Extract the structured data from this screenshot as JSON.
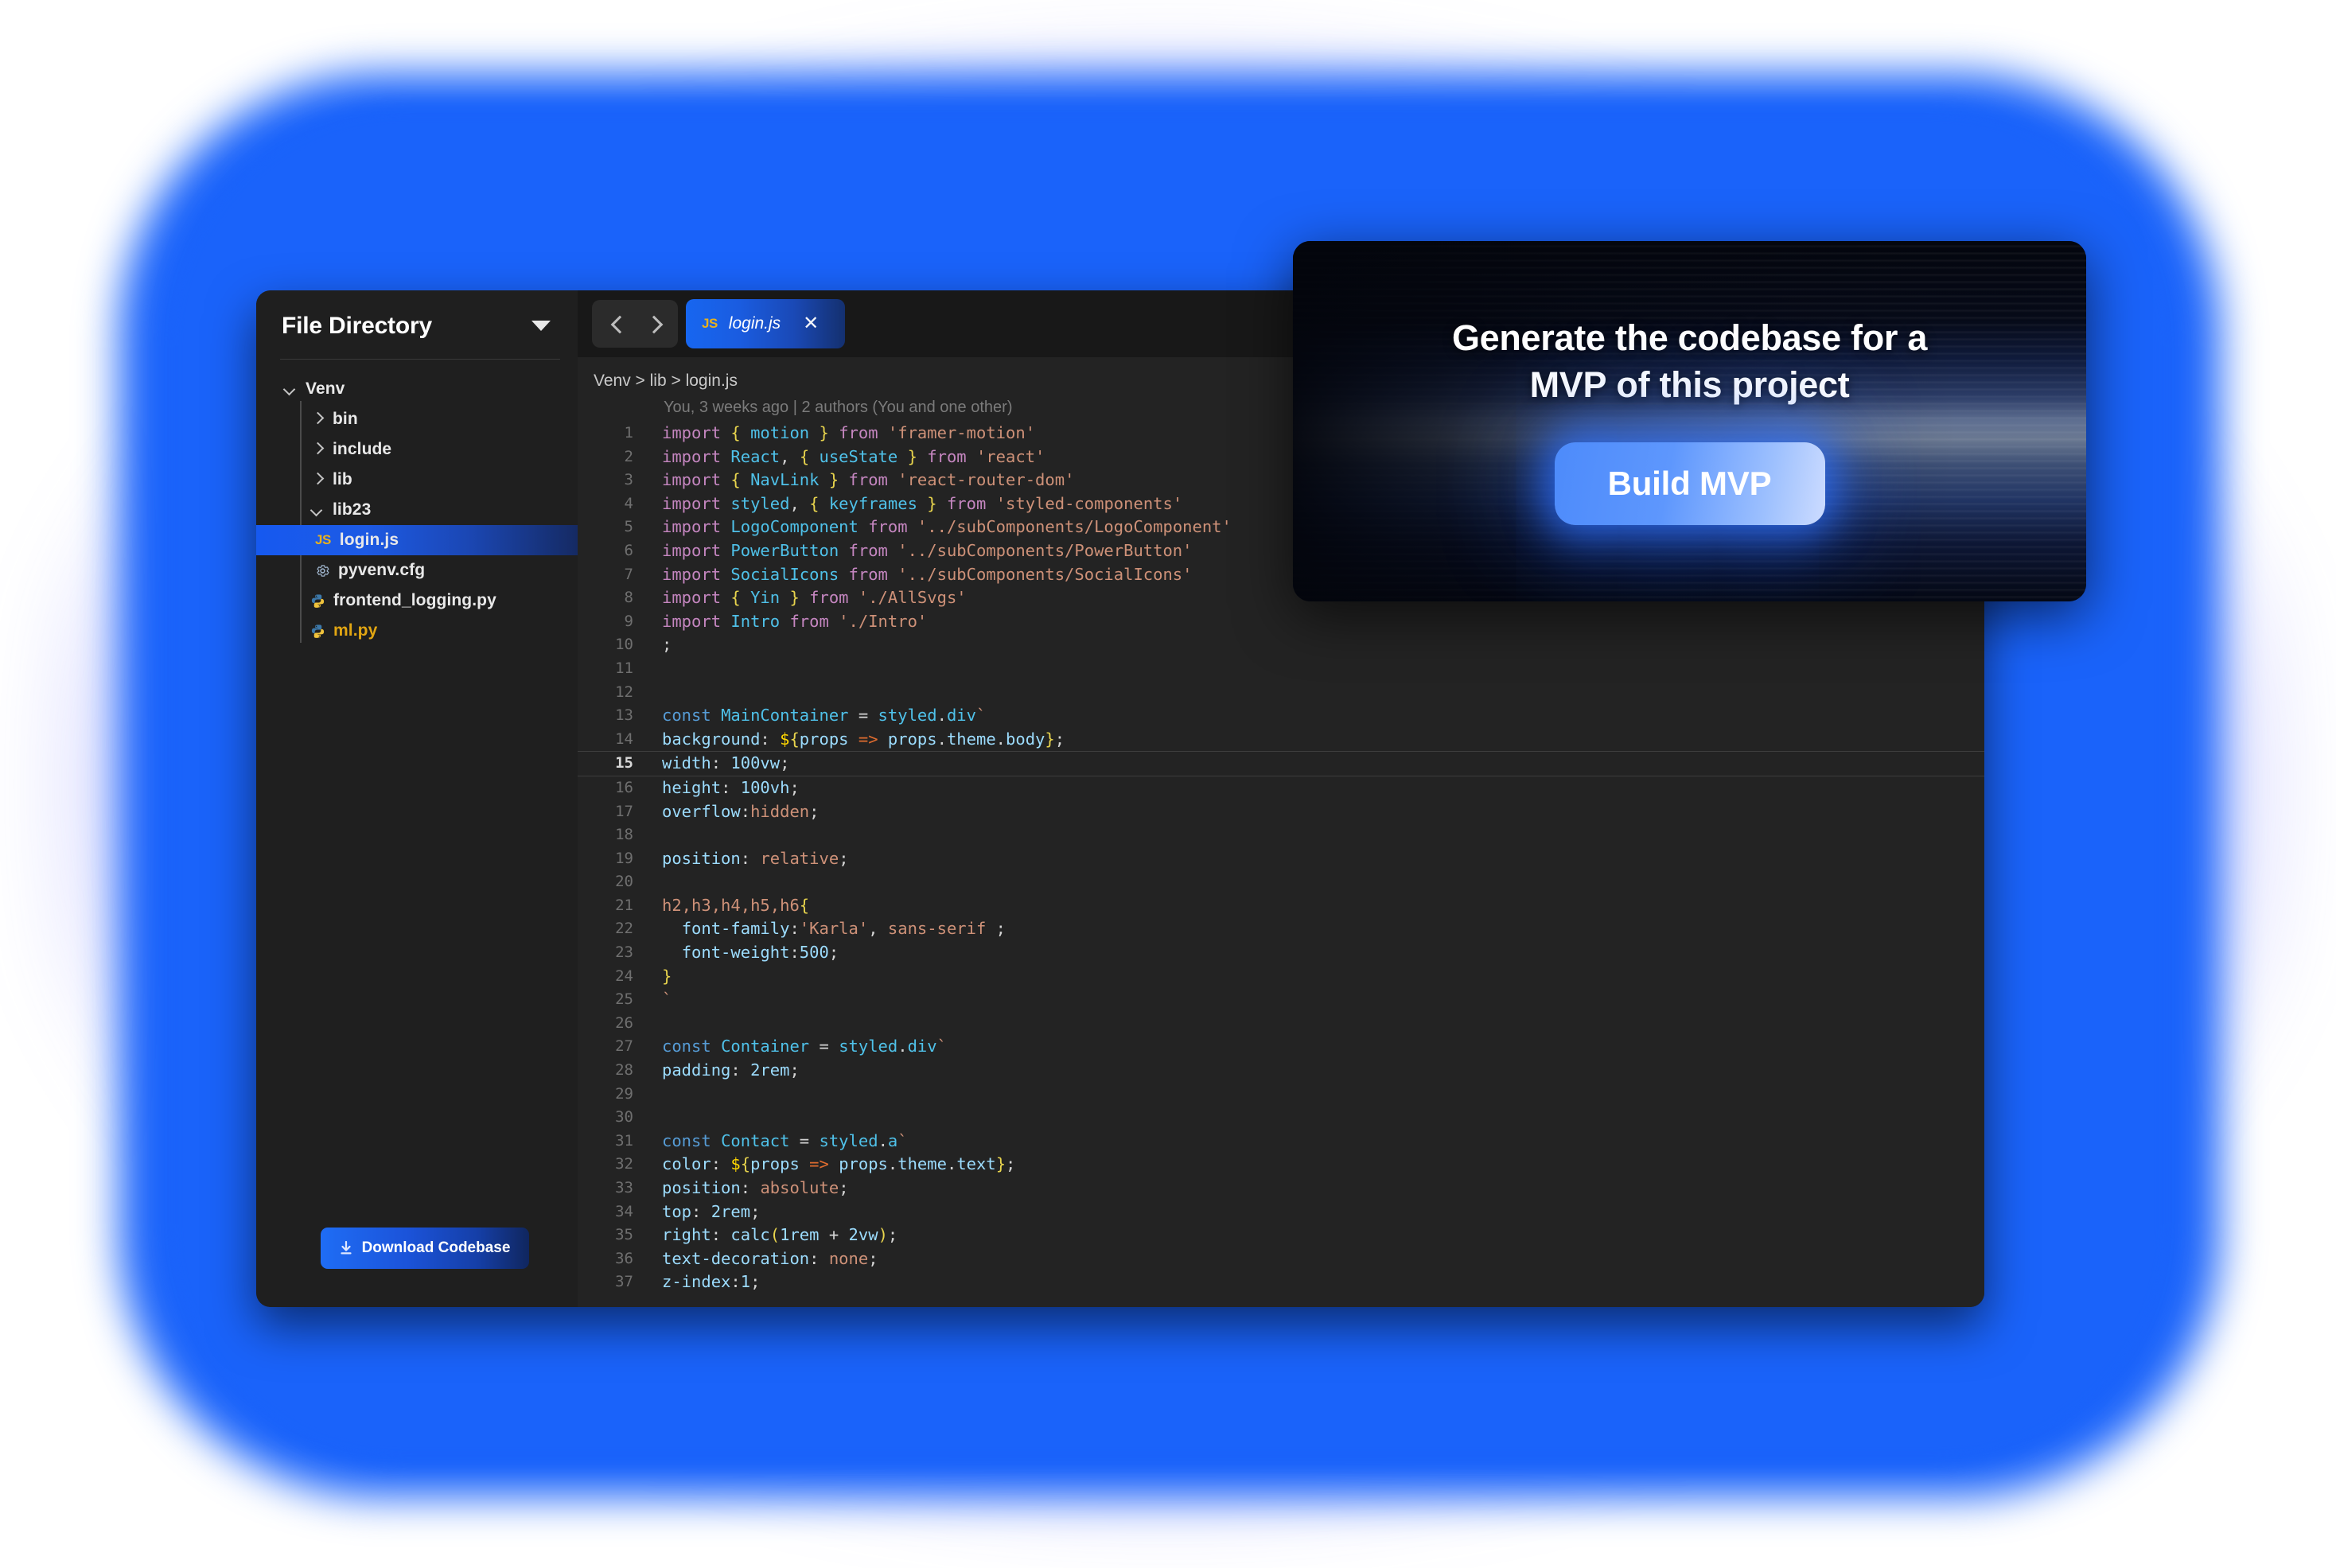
{
  "theme": {
    "accent_blue": "#1a63fa",
    "window_bg": "#232323",
    "sidebar_bg": "#1f1f1f",
    "tabbar_bg": "#181818",
    "selection_blue": "#1659f0",
    "js_icon_color": "#e8b11e",
    "modified_file_color": "#e2a612"
  },
  "sidebar": {
    "title": "File Directory",
    "collapse_icon": "chevron-down-icon",
    "items": [
      {
        "label": "Venv",
        "depth": 1,
        "icon": "chevron-down-icon",
        "state": "expanded",
        "selected": false,
        "modified": false
      },
      {
        "label": "bin",
        "depth": 2,
        "icon": "chevron-right-icon",
        "state": "collapsed",
        "selected": false,
        "modified": false
      },
      {
        "label": "include",
        "depth": 2,
        "icon": "chevron-right-icon",
        "state": "collapsed",
        "selected": false,
        "modified": false
      },
      {
        "label": "lib",
        "depth": 2,
        "icon": "chevron-right-icon",
        "state": "collapsed",
        "selected": false,
        "modified": false
      },
      {
        "label": "lib23",
        "depth": 2,
        "icon": "chevron-down-icon",
        "state": "expanded",
        "selected": false,
        "modified": false
      },
      {
        "label": "login.js",
        "depth": 3,
        "icon": "js-file-icon",
        "state": "file",
        "selected": true,
        "modified": false
      },
      {
        "label": "pyvenv.cfg",
        "depth": 3,
        "icon": "gear-file-icon",
        "state": "file",
        "selected": false,
        "modified": false
      },
      {
        "label": "frontend_logging.py",
        "depth": 2,
        "icon": "python-file-icon",
        "state": "file",
        "selected": false,
        "modified": false
      },
      {
        "label": "ml.py",
        "depth": 2,
        "icon": "python-file-icon",
        "state": "file",
        "selected": false,
        "modified": true
      }
    ],
    "download_button": {
      "label": "Download Codebase",
      "icon": "download-icon"
    }
  },
  "editor": {
    "nav_back_icon": "chevron-left-icon",
    "nav_forward_icon": "chevron-right-icon",
    "tabs": [
      {
        "file_type": "JS",
        "name": "login.js",
        "close_icon": "close-icon",
        "active": true
      }
    ],
    "breadcrumb": "Venv > lib > login.js",
    "blame": "You, 3 weeks ago | 2 authors (You and one other)",
    "current_line": 15,
    "lines": [
      {
        "n": 1,
        "tokens": [
          [
            "k",
            "import"
          ],
          [
            "op",
            " "
          ],
          [
            "br",
            "{"
          ],
          [
            "op",
            " "
          ],
          [
            "fn",
            "motion"
          ],
          [
            "op",
            " "
          ],
          [
            "br",
            "}"
          ],
          [
            "op",
            " "
          ],
          [
            "k",
            "from"
          ],
          [
            "op",
            " "
          ],
          [
            "str",
            "'framer-motion'"
          ]
        ]
      },
      {
        "n": 2,
        "tokens": [
          [
            "k",
            "import"
          ],
          [
            "op",
            " "
          ],
          [
            "fn",
            "React"
          ],
          [
            "op",
            ", "
          ],
          [
            "br",
            "{"
          ],
          [
            "op",
            " "
          ],
          [
            "fn",
            "useState"
          ],
          [
            "op",
            " "
          ],
          [
            "br",
            "}"
          ],
          [
            "op",
            " "
          ],
          [
            "k",
            "from"
          ],
          [
            "op",
            " "
          ],
          [
            "str",
            "'react'"
          ]
        ]
      },
      {
        "n": 3,
        "tokens": [
          [
            "k",
            "import"
          ],
          [
            "op",
            " "
          ],
          [
            "br",
            "{"
          ],
          [
            "op",
            " "
          ],
          [
            "fn",
            "NavLink"
          ],
          [
            "op",
            " "
          ],
          [
            "br",
            "}"
          ],
          [
            "op",
            " "
          ],
          [
            "k",
            "from"
          ],
          [
            "op",
            " "
          ],
          [
            "str",
            "'react-router-dom'"
          ]
        ]
      },
      {
        "n": 4,
        "tokens": [
          [
            "k",
            "import"
          ],
          [
            "op",
            " "
          ],
          [
            "fn",
            "styled"
          ],
          [
            "op",
            ", "
          ],
          [
            "br",
            "{"
          ],
          [
            "op",
            " "
          ],
          [
            "fn",
            "keyframes"
          ],
          [
            "op",
            " "
          ],
          [
            "br",
            "}"
          ],
          [
            "op",
            " "
          ],
          [
            "k",
            "from"
          ],
          [
            "op",
            " "
          ],
          [
            "str",
            "'styled-components'"
          ]
        ]
      },
      {
        "n": 5,
        "tokens": [
          [
            "k",
            "import"
          ],
          [
            "op",
            " "
          ],
          [
            "fn",
            "LogoComponent"
          ],
          [
            "op",
            " "
          ],
          [
            "k",
            "from"
          ],
          [
            "op",
            " "
          ],
          [
            "str",
            "'../subComponents/LogoComponent'"
          ]
        ]
      },
      {
        "n": 6,
        "tokens": [
          [
            "k",
            "import"
          ],
          [
            "op",
            " "
          ],
          [
            "fn",
            "PowerButton"
          ],
          [
            "op",
            " "
          ],
          [
            "k",
            "from"
          ],
          [
            "op",
            " "
          ],
          [
            "str",
            "'../subComponents/PowerButton'"
          ]
        ]
      },
      {
        "n": 7,
        "tokens": [
          [
            "k",
            "import"
          ],
          [
            "op",
            " "
          ],
          [
            "fn",
            "SocialIcons"
          ],
          [
            "op",
            " "
          ],
          [
            "k",
            "from"
          ],
          [
            "op",
            " "
          ],
          [
            "str",
            "'../subComponents/SocialIcons'"
          ]
        ]
      },
      {
        "n": 8,
        "tokens": [
          [
            "k",
            "import"
          ],
          [
            "op",
            " "
          ],
          [
            "br",
            "{"
          ],
          [
            "op",
            " "
          ],
          [
            "fn",
            "Yin"
          ],
          [
            "op",
            " "
          ],
          [
            "br",
            "}"
          ],
          [
            "op",
            " "
          ],
          [
            "k",
            "from"
          ],
          [
            "op",
            " "
          ],
          [
            "str",
            "'./AllSvgs'"
          ]
        ]
      },
      {
        "n": 9,
        "tokens": [
          [
            "k",
            "import"
          ],
          [
            "op",
            " "
          ],
          [
            "fn",
            "Intro"
          ],
          [
            "op",
            " "
          ],
          [
            "k",
            "from"
          ],
          [
            "op",
            " "
          ],
          [
            "str",
            "'./Intro'"
          ]
        ]
      },
      {
        "n": 10,
        "tokens": [
          [
            "op",
            ";"
          ]
        ]
      },
      {
        "n": 11,
        "tokens": []
      },
      {
        "n": 12,
        "tokens": []
      },
      {
        "n": 13,
        "tokens": [
          [
            "kw",
            "const"
          ],
          [
            "op",
            " "
          ],
          [
            "fn",
            "MainContainer"
          ],
          [
            "op",
            " = "
          ],
          [
            "fn",
            "styled"
          ],
          [
            "op",
            "."
          ],
          [
            "fn",
            "div"
          ],
          [
            "tick",
            "`"
          ]
        ]
      },
      {
        "n": 14,
        "tokens": [
          [
            "id",
            "background"
          ],
          [
            "op",
            ": "
          ],
          [
            "pl",
            "$"
          ],
          [
            "br",
            "{"
          ],
          [
            "id",
            "props"
          ],
          [
            "op",
            " "
          ],
          [
            "arw",
            "=>"
          ],
          [
            "op",
            " "
          ],
          [
            "id",
            "props"
          ],
          [
            "op",
            "."
          ],
          [
            "id",
            "theme"
          ],
          [
            "op",
            "."
          ],
          [
            "id",
            "body"
          ],
          [
            "br",
            "}"
          ],
          [
            "op",
            ";"
          ]
        ]
      },
      {
        "n": 15,
        "tokens": [
          [
            "id",
            "width"
          ],
          [
            "op",
            ": "
          ],
          [
            "id",
            "100vw"
          ],
          [
            "op",
            ";"
          ]
        ]
      },
      {
        "n": 16,
        "tokens": [
          [
            "id",
            "height"
          ],
          [
            "op",
            ": "
          ],
          [
            "id",
            "100vh"
          ],
          [
            "op",
            ";"
          ]
        ]
      },
      {
        "n": 17,
        "tokens": [
          [
            "id",
            "overflow"
          ],
          [
            "op",
            ":"
          ],
          [
            "val",
            "hidden"
          ],
          [
            "op",
            ";"
          ]
        ]
      },
      {
        "n": 18,
        "tokens": []
      },
      {
        "n": 19,
        "tokens": [
          [
            "id",
            "position"
          ],
          [
            "op",
            ": "
          ],
          [
            "val",
            "relative"
          ],
          [
            "op",
            ";"
          ]
        ]
      },
      {
        "n": 20,
        "tokens": []
      },
      {
        "n": 21,
        "tokens": [
          [
            "val",
            "h2,h3,h4,h5,h6"
          ],
          [
            "br",
            "{"
          ]
        ]
      },
      {
        "n": 22,
        "tokens": [
          [
            "op",
            "  "
          ],
          [
            "id",
            "font-family"
          ],
          [
            "op",
            ":"
          ],
          [
            "str",
            "'Karla'"
          ],
          [
            "op",
            ", "
          ],
          [
            "val",
            "sans-serif"
          ],
          [
            "op",
            " ;"
          ]
        ]
      },
      {
        "n": 23,
        "tokens": [
          [
            "op",
            "  "
          ],
          [
            "id",
            "font-weight"
          ],
          [
            "op",
            ":"
          ],
          [
            "id",
            "500"
          ],
          [
            "op",
            ";"
          ]
        ]
      },
      {
        "n": 24,
        "tokens": [
          [
            "br",
            "}"
          ]
        ]
      },
      {
        "n": 25,
        "tokens": [
          [
            "tick",
            "`"
          ]
        ]
      },
      {
        "n": 26,
        "tokens": []
      },
      {
        "n": 27,
        "tokens": [
          [
            "kw",
            "const"
          ],
          [
            "op",
            " "
          ],
          [
            "fn",
            "Container"
          ],
          [
            "op",
            " = "
          ],
          [
            "fn",
            "styled"
          ],
          [
            "op",
            "."
          ],
          [
            "fn",
            "div"
          ],
          [
            "tick",
            "`"
          ]
        ]
      },
      {
        "n": 28,
        "tokens": [
          [
            "id",
            "padding"
          ],
          [
            "op",
            ": "
          ],
          [
            "id",
            "2rem"
          ],
          [
            "op",
            ";"
          ]
        ]
      },
      {
        "n": 29,
        "tokens": []
      },
      {
        "n": 30,
        "tokens": []
      },
      {
        "n": 31,
        "tokens": [
          [
            "kw",
            "const"
          ],
          [
            "op",
            " "
          ],
          [
            "fn",
            "Contact"
          ],
          [
            "op",
            " = "
          ],
          [
            "fn",
            "styled"
          ],
          [
            "op",
            "."
          ],
          [
            "fn",
            "a"
          ],
          [
            "tick",
            "`"
          ]
        ]
      },
      {
        "n": 32,
        "tokens": [
          [
            "id",
            "color"
          ],
          [
            "op",
            ": "
          ],
          [
            "pl",
            "$"
          ],
          [
            "br",
            "{"
          ],
          [
            "id",
            "props"
          ],
          [
            "op",
            " "
          ],
          [
            "arw",
            "=>"
          ],
          [
            "op",
            " "
          ],
          [
            "id",
            "props"
          ],
          [
            "op",
            "."
          ],
          [
            "id",
            "theme"
          ],
          [
            "op",
            "."
          ],
          [
            "id",
            "text"
          ],
          [
            "br",
            "}"
          ],
          [
            "op",
            ";"
          ]
        ]
      },
      {
        "n": 33,
        "tokens": [
          [
            "id",
            "position"
          ],
          [
            "op",
            ": "
          ],
          [
            "val",
            "absolute"
          ],
          [
            "op",
            ";"
          ]
        ]
      },
      {
        "n": 34,
        "tokens": [
          [
            "id",
            "top"
          ],
          [
            "op",
            ": "
          ],
          [
            "id",
            "2rem"
          ],
          [
            "op",
            ";"
          ]
        ]
      },
      {
        "n": 35,
        "tokens": [
          [
            "id",
            "right"
          ],
          [
            "op",
            ": "
          ],
          [
            "id",
            "calc"
          ],
          [
            "br",
            "("
          ],
          [
            "id",
            "1rem"
          ],
          [
            "op",
            " + "
          ],
          [
            "id",
            "2vw"
          ],
          [
            "br",
            ")"
          ],
          [
            "op",
            ";"
          ]
        ]
      },
      {
        "n": 36,
        "tokens": [
          [
            "id",
            "text-decoration"
          ],
          [
            "op",
            ": "
          ],
          [
            "val",
            "none"
          ],
          [
            "op",
            ";"
          ]
        ]
      },
      {
        "n": 37,
        "tokens": [
          [
            "id",
            "z-index"
          ],
          [
            "op",
            ":"
          ],
          [
            "id",
            "1"
          ],
          [
            "op",
            ";"
          ]
        ]
      }
    ]
  },
  "modal": {
    "title_line1": "Generate the codebase for a",
    "title_line2_strong": "MVP",
    "title_line2_rest": " of this project",
    "button_label": "Build MVP"
  }
}
